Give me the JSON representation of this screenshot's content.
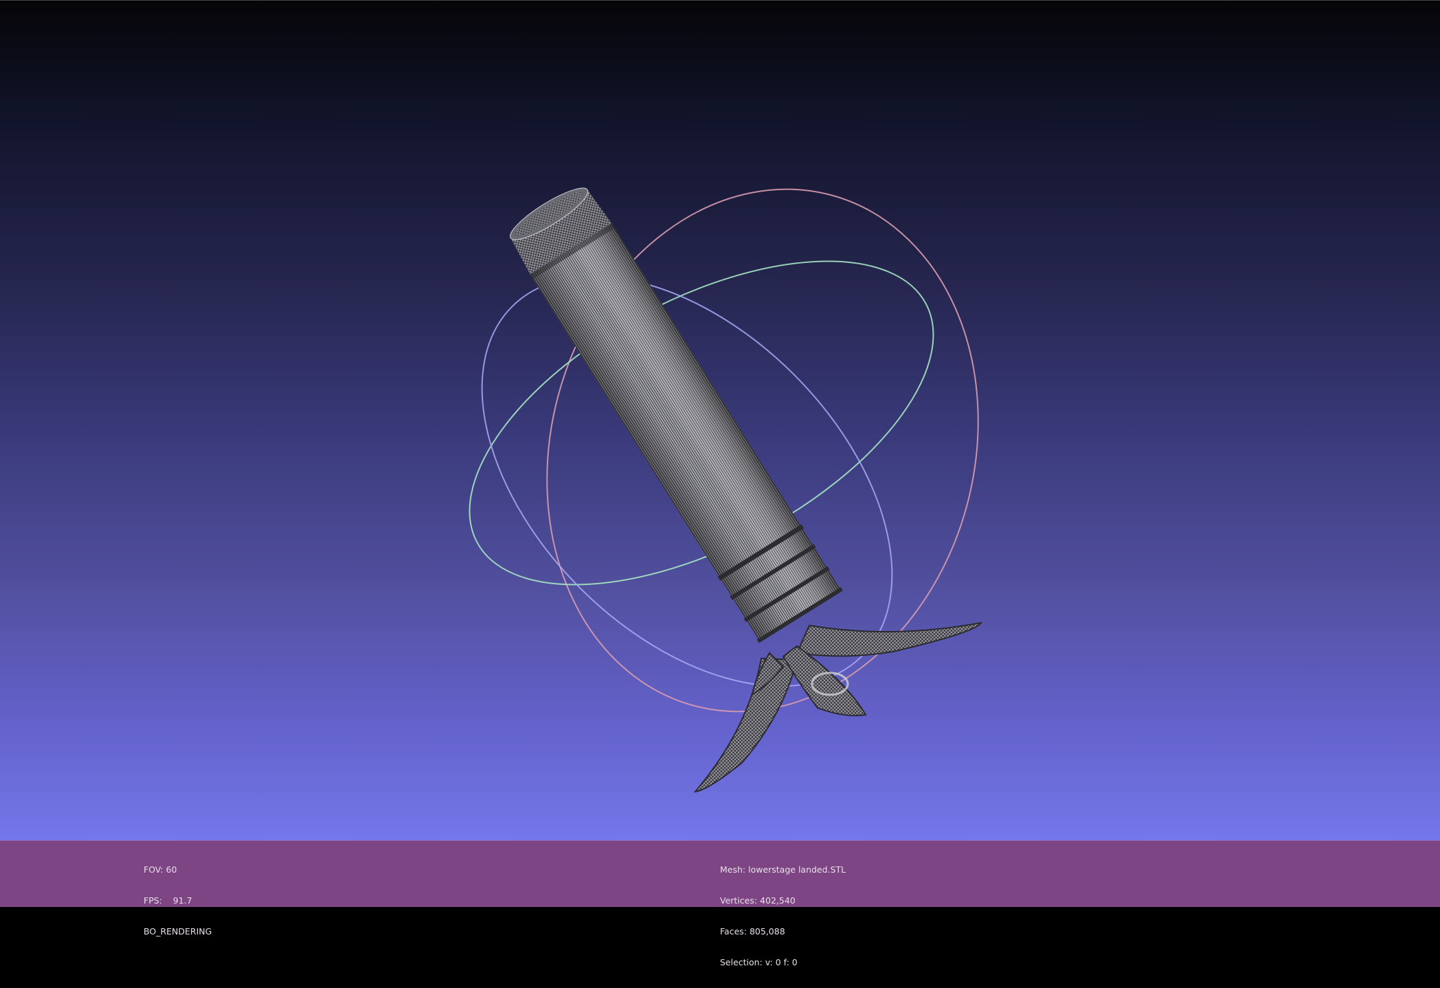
{
  "viewer": {
    "render_info": {
      "fov_label": "FOV: 60",
      "fps_label": "FPS:",
      "fps_value": "91.7",
      "render_mode": "BO_RENDERING"
    },
    "mesh_info": {
      "mesh": "Mesh: lowerstage landed.STL",
      "vertices": "Vertices: 402,540",
      "faces": "Faces: 805,088",
      "selection": "Selection: v: 0 f: 0"
    }
  },
  "colors": {
    "background_top": "#050508",
    "background_bottom": "#7477ea",
    "info_bar": "#7d4583",
    "mesh_wire": "#d8d8d8",
    "mesh_dark": "#3a3a3e",
    "trackball_red": "#e8a0b0",
    "trackball_green": "#a8e8c0",
    "trackball_blue": "#b0b0ff"
  },
  "icons": {
    "trackball": "trackball-gizmo",
    "model": "rocket-stage-wireframe"
  }
}
